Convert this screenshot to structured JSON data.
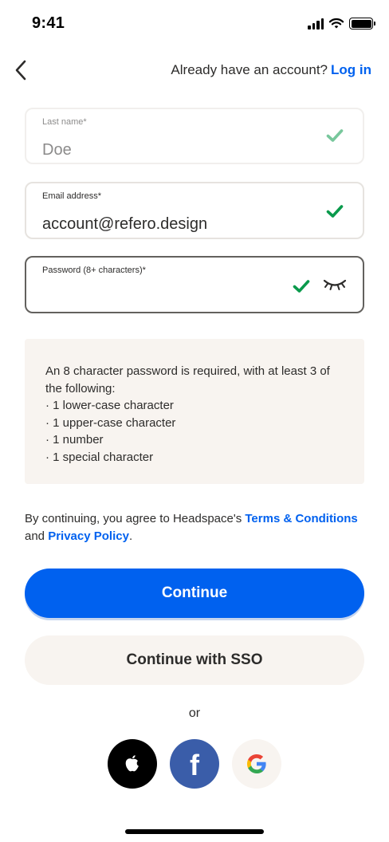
{
  "status_bar": {
    "time": "9:41"
  },
  "nav": {
    "prompt": "Already have an account?",
    "login_label": "Log in"
  },
  "form": {
    "last_name": {
      "label": "Last name*",
      "value": "Doe"
    },
    "email": {
      "label": "Email address*",
      "value": "account@refero.design"
    },
    "password": {
      "label": "Password (8+ characters)*",
      "value": ""
    }
  },
  "rules": {
    "intro": "An 8 character password is required, with at least 3 of the following:",
    "items": [
      "1 lower-case character",
      "1 upper-case character",
      "1 number",
      "1 special character"
    ]
  },
  "legal": {
    "prefix": "By continuing, you agree to Headspace's ",
    "terms_label": "Terms & Conditions",
    "and": " and ",
    "privacy_label": "Privacy Policy",
    "suffix": "."
  },
  "buttons": {
    "continue": "Continue",
    "sso": "Continue with SSO"
  },
  "divider": "or",
  "social": {
    "icons": [
      "apple-icon",
      "facebook-icon",
      "google-icon"
    ]
  },
  "colors": {
    "accent": "#0061ef",
    "check_green": "#0a9a4c",
    "surface": "#f8f4f0",
    "facebook": "#3a5da9"
  }
}
